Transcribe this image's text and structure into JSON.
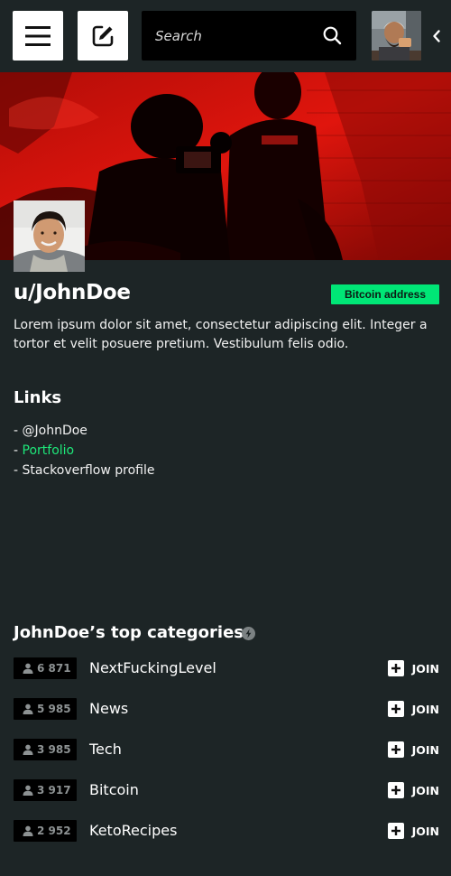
{
  "header": {
    "search_placeholder": "Search",
    "icons": [
      "menu-icon",
      "edit-icon",
      "search-icon",
      "chevron-left-icon"
    ]
  },
  "profile": {
    "username": "u/JohnDoe",
    "bitcoin_label": "Bitcoin address",
    "bio": "Lorem ipsum dolor sit amet, consectetur adipiscing elit. Integer a tortor et velit posuere pretium. Vestibulum felis odio."
  },
  "links": {
    "heading": "Links",
    "items": [
      {
        "label": "- @JohnDoe"
      },
      {
        "prefix": "- ",
        "label": "Portfolio"
      },
      {
        "label": "- Stackoverflow profile"
      }
    ]
  },
  "categories": {
    "heading": "JohnDoe’s top categories",
    "join_label": "JOIN",
    "items": [
      {
        "members": "6 871",
        "name": "NextFuckingLevel"
      },
      {
        "members": "5 985",
        "name": "News"
      },
      {
        "members": "3 985",
        "name": "Tech"
      },
      {
        "members": "3 917",
        "name": "Bitcoin"
      },
      {
        "members": "2 952",
        "name": "KetoRecipes"
      }
    ]
  },
  "colors": {
    "background": "#1d2526",
    "accent_green": "#00e676",
    "link_green": "#1ee87a",
    "banner_red": "#c8100a"
  }
}
